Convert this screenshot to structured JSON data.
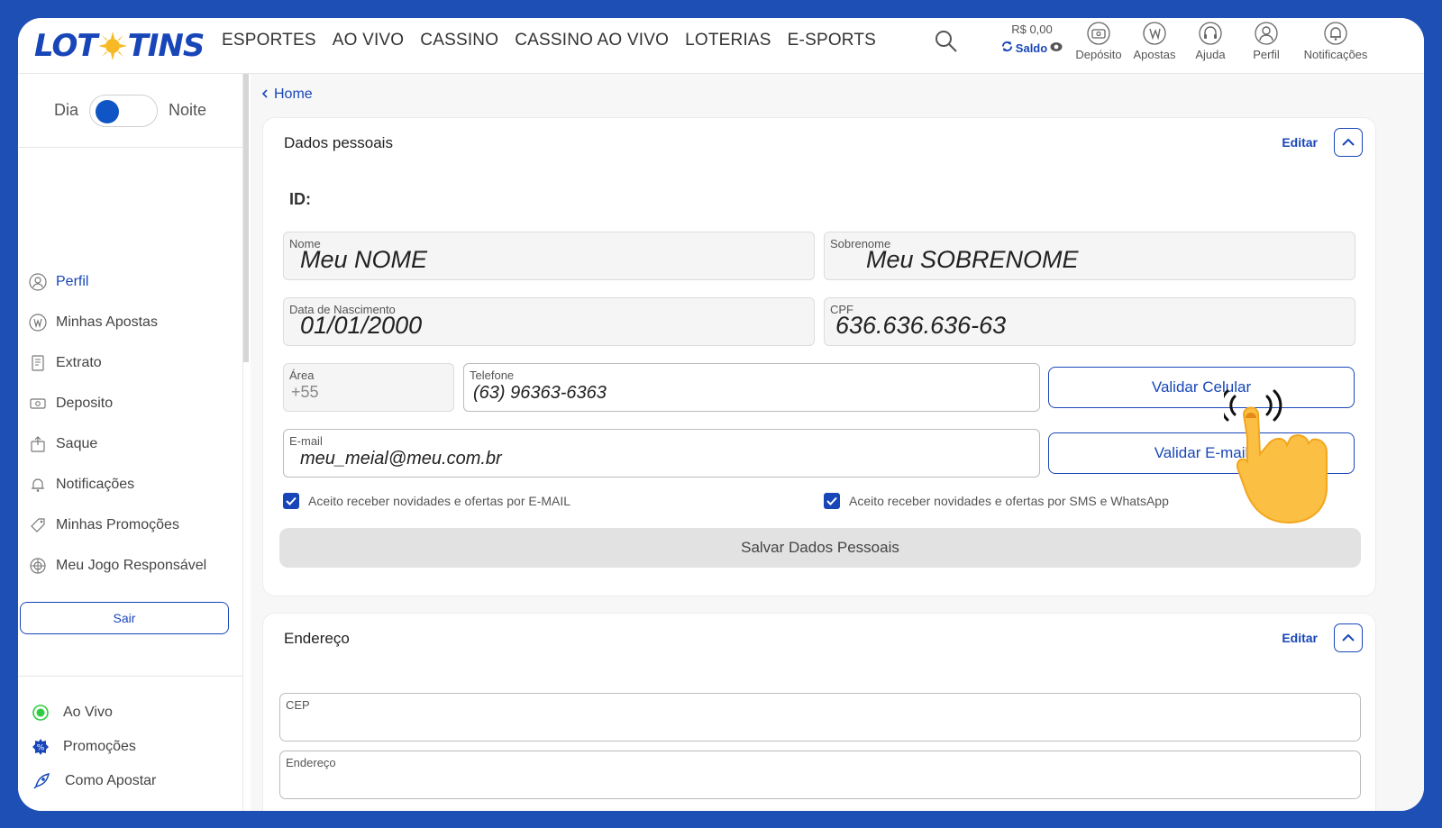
{
  "header": {
    "logo_left": "LOT",
    "logo_right": "TINS",
    "nav": [
      "ESPORTES",
      "AO VIVO",
      "CASSINO",
      "CASSINO AO VIVO",
      "LOTERIAS",
      "E-SPORTS"
    ],
    "balance": "R$ 0,00",
    "balance_label": "Saldo",
    "icons": [
      {
        "label": "Depósito",
        "icon": "wallet-icon"
      },
      {
        "label": "Apostas",
        "icon": "bets-icon"
      },
      {
        "label": "Ajuda",
        "icon": "headset-icon"
      },
      {
        "label": "Perfil",
        "icon": "user-icon"
      },
      {
        "label": "Notificações",
        "icon": "bell-icon"
      }
    ]
  },
  "sidebar": {
    "theme_day": "Dia",
    "theme_night": "Noite",
    "menu": [
      {
        "label": "Perfil",
        "icon": "user-icon",
        "active": true
      },
      {
        "label": "Minhas Apostas",
        "icon": "bets-icon"
      },
      {
        "label": "Extrato",
        "icon": "statement-icon"
      },
      {
        "label": "Deposito",
        "icon": "wallet-icon"
      },
      {
        "label": "Saque",
        "icon": "withdraw-icon"
      },
      {
        "label": "Notificações",
        "icon": "bell-icon"
      },
      {
        "label": "Minhas Promoções",
        "icon": "tag-icon"
      },
      {
        "label": "Meu Jogo Responsável",
        "icon": "responsible-icon"
      }
    ],
    "logout": "Sair",
    "bottom": [
      {
        "label": "Ao Vivo",
        "icon": "live-dot-icon"
      },
      {
        "label": "Promoções",
        "icon": "promo-badge-icon"
      },
      {
        "label": "Como Apostar",
        "icon": "rocket-icon"
      }
    ]
  },
  "breadcrumb": {
    "label": "Home"
  },
  "personal": {
    "title": "Dados pessoais",
    "edit": "Editar",
    "id_label": "ID:",
    "nome_label": "Nome",
    "nome_value": "Meu NOME",
    "sobrenome_label": "Sobrenome",
    "sobrenome_value": "Meu SOBRENOME",
    "nascimento_label": "Data de Nascimento",
    "nascimento_value": "01/01/2000",
    "cpf_label": "CPF",
    "cpf_value": "636.636.636-63",
    "area_label": "Área",
    "area_value": "+55",
    "telefone_label": "Telefone",
    "telefone_value": "(63) 96363-6363",
    "email_label": "E-mail",
    "email_value": "meu_meial@meu.com.br",
    "validar_celular": "Validar Celular",
    "validar_email": "Validar E-mail",
    "optin_email": "Aceito receber novidades e ofertas por E-MAIL",
    "optin_sms": "Aceito receber novidades e ofertas por SMS e WhatsApp",
    "save": "Salvar Dados Pessoais"
  },
  "address": {
    "title": "Endereço",
    "edit": "Editar",
    "cep_label": "CEP",
    "endereco_label": "Endereço"
  },
  "colors": {
    "brand": "#1846b8",
    "frame": "#1e4fb4",
    "sun": "#f7b924"
  }
}
